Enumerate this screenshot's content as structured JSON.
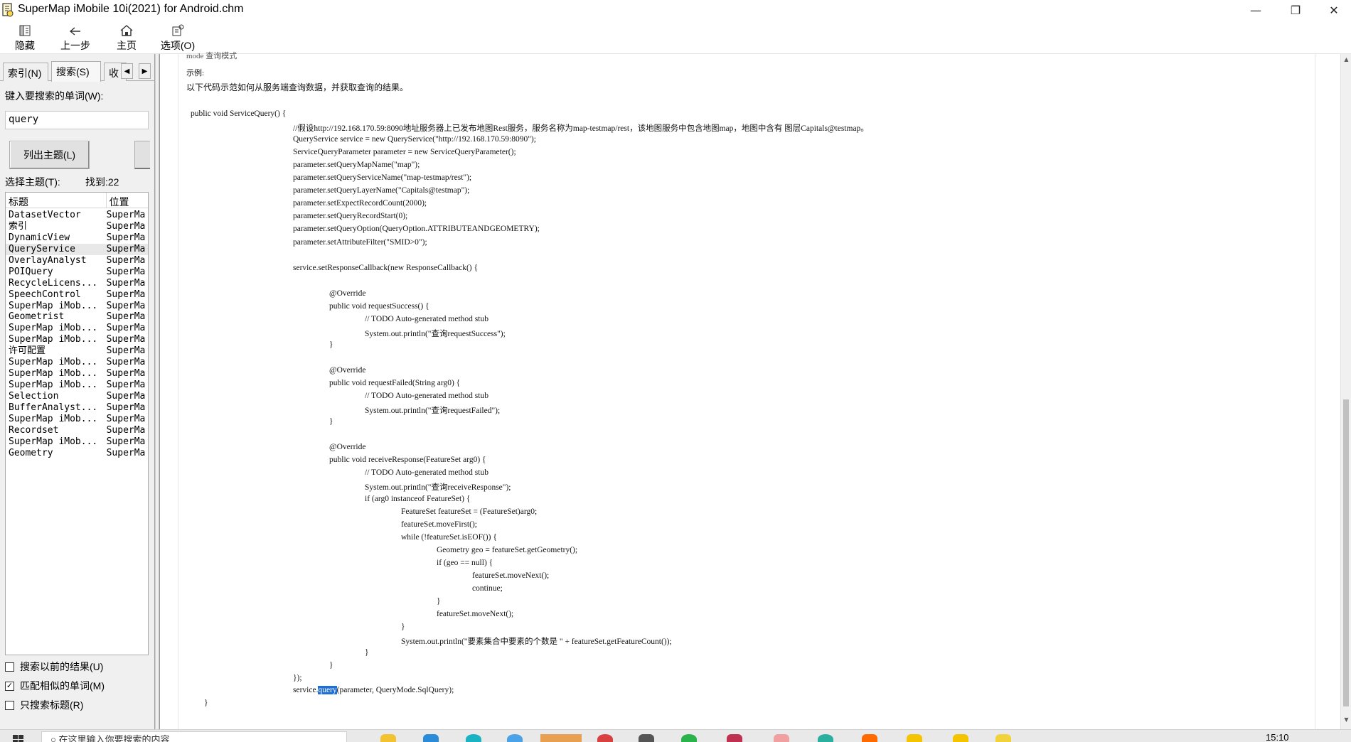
{
  "window": {
    "title": "SuperMap iMobile 10i(2021) for Android.chm",
    "minimize_glyph": "—",
    "maximize_glyph": "❐",
    "close_glyph": "✕"
  },
  "toolbar": {
    "hide": "隐藏",
    "back": "上一步",
    "home": "主页",
    "options": "选项(O)"
  },
  "left_pane": {
    "tabs": [
      "索引(N)",
      "搜索(S)",
      "收"
    ],
    "search_label": "键入要搜索的单词(W):",
    "search_value": "query",
    "list_topics_button": "列出主题(L)",
    "select_topic_label": "选择主题(T):",
    "found_label": "找到:22",
    "columns": [
      "标题",
      "位置"
    ],
    "results": [
      [
        "DatasetVector",
        "SuperMa"
      ],
      [
        "索引",
        "SuperMa"
      ],
      [
        "DynamicView",
        "SuperMa"
      ],
      [
        "QueryService",
        "SuperMa"
      ],
      [
        "OverlayAnalyst",
        "SuperMa"
      ],
      [
        "POIQuery",
        "SuperMa"
      ],
      [
        "RecycleLicens...",
        "SuperMa"
      ],
      [
        "SpeechControl",
        "SuperMa"
      ],
      [
        "SuperMap iMob...",
        "SuperMa"
      ],
      [
        "Geometrist",
        "SuperMa"
      ],
      [
        "SuperMap iMob...",
        "SuperMa"
      ],
      [
        "SuperMap iMob...",
        "SuperMa"
      ],
      [
        "许可配置",
        "SuperMa"
      ],
      [
        "SuperMap iMob...",
        "SuperMa"
      ],
      [
        "SuperMap iMob...",
        "SuperMa"
      ],
      [
        "SuperMap iMob...",
        "SuperMa"
      ],
      [
        "Selection",
        "SuperMa"
      ],
      [
        "BufferAnalyst...",
        "SuperMa"
      ],
      [
        "SuperMap iMob...",
        "SuperMa"
      ],
      [
        "Recordset",
        "SuperMa"
      ],
      [
        "SuperMap iMob...",
        "SuperMa"
      ],
      [
        "Geometry",
        "SuperMa"
      ]
    ],
    "selected_index": 3,
    "options": [
      {
        "label": "搜索以前的结果(U)",
        "checked": false
      },
      {
        "label": "匹配相似的单词(M)",
        "checked": true
      },
      {
        "label": "只搜索标题(R)",
        "checked": false
      }
    ]
  },
  "content": {
    "cut_heading": "mode   查询模式",
    "example_label": "示例:",
    "intro": "以下代码示范如何从服务端查询数据，并获取查询的结果。",
    "code_lines": [
      {
        "indent": 0,
        "text": "public void ServiceQuery() {"
      },
      {
        "indent": 1,
        "text": "//假设http://192.168.170.59:8090地址服务器上已发布地图Rest服务，服务名称为map-testmap/rest，该地图服务中包含地图map，地图中含有 图层Capitals@testmap。"
      },
      {
        "indent": 1,
        "text": "QueryService service = new QueryService(\"http://192.168.170.59:8090\");"
      },
      {
        "indent": 1,
        "text": "ServiceQueryParameter parameter = new ServiceQueryParameter();"
      },
      {
        "indent": 1,
        "text": "parameter.setQueryMapName(\"map\");"
      },
      {
        "indent": 1,
        "text": "parameter.setQueryServiceName(\"map-testmap/rest\");"
      },
      {
        "indent": 1,
        "text": "parameter.setQueryLayerName(\"Capitals@testmap\");"
      },
      {
        "indent": 1,
        "text": "parameter.setExpectRecordCount(2000);"
      },
      {
        "indent": 1,
        "text": "parameter.setQueryRecordStart(0);"
      },
      {
        "indent": 1,
        "text": "parameter.setQueryOption(QueryOption.ATTRIBUTEANDGEOMETRY);"
      },
      {
        "indent": 1,
        "text": "parameter.setAttributeFilter(\"SMID>0\");"
      },
      {
        "indent": 1,
        "text": ""
      },
      {
        "indent": 1,
        "text": "service.setResponseCallback(new ResponseCallback() {"
      },
      {
        "indent": 1,
        "text": ""
      },
      {
        "indent": 2,
        "text": "@Override"
      },
      {
        "indent": 2,
        "text": "public void requestSuccess() {"
      },
      {
        "indent": 3,
        "text": "// TODO Auto-generated method stub"
      },
      {
        "indent": 3,
        "text": "System.out.println(\"查询requestSuccess\");"
      },
      {
        "indent": 2,
        "text": "}"
      },
      {
        "indent": 2,
        "text": ""
      },
      {
        "indent": 2,
        "text": "@Override"
      },
      {
        "indent": 2,
        "text": "public void requestFailed(String arg0) {"
      },
      {
        "indent": 3,
        "text": "// TODO Auto-generated method stub"
      },
      {
        "indent": 3,
        "text": "System.out.println(\"查询requestFailed\");"
      },
      {
        "indent": 2,
        "text": "}"
      },
      {
        "indent": 2,
        "text": ""
      },
      {
        "indent": 2,
        "text": "@Override"
      },
      {
        "indent": 2,
        "text": "public void receiveResponse(FeatureSet arg0) {"
      },
      {
        "indent": 3,
        "text": "// TODO Auto-generated method stub"
      },
      {
        "indent": 3,
        "text": "System.out.println(\"查询receiveResponse\");"
      },
      {
        "indent": 3,
        "text": "if (arg0 instanceof FeatureSet) {"
      },
      {
        "indent": 4,
        "text": "FeatureSet featureSet = (FeatureSet)arg0;"
      },
      {
        "indent": 4,
        "text": "featureSet.moveFirst();"
      },
      {
        "indent": 4,
        "text": "while (!featureSet.isEOF()) {"
      },
      {
        "indent": 5,
        "text": "Geometry geo = featureSet.getGeometry();"
      },
      {
        "indent": 5,
        "text": "if (geo == null) {"
      },
      {
        "indent": 6,
        "text": "featureSet.moveNext();"
      },
      {
        "indent": 6,
        "text": "continue;"
      },
      {
        "indent": 5,
        "text": "}"
      },
      {
        "indent": 5,
        "text": "featureSet.moveNext();"
      },
      {
        "indent": 4,
        "text": "}"
      },
      {
        "indent": 4,
        "text": "System.out.println(\"要素集合中要素的个数是 \" + featureSet.getFeatureCount());"
      },
      {
        "indent": 3,
        "text": "}"
      },
      {
        "indent": 2,
        "text": "}"
      },
      {
        "indent": 1,
        "text": "});"
      }
    ],
    "last_line_prefix": "service.",
    "last_line_highlight": "query",
    "last_line_suffix": "(parameter, QueryMode.SqlQuery);",
    "closing_brace": "}"
  },
  "taskbar": {
    "search_placeholder": "在这里输入你要搜索的内容",
    "clock": "15:10"
  },
  "colors": {
    "highlight": "#1f6fd6",
    "selected_row": "#e8e8e8"
  }
}
